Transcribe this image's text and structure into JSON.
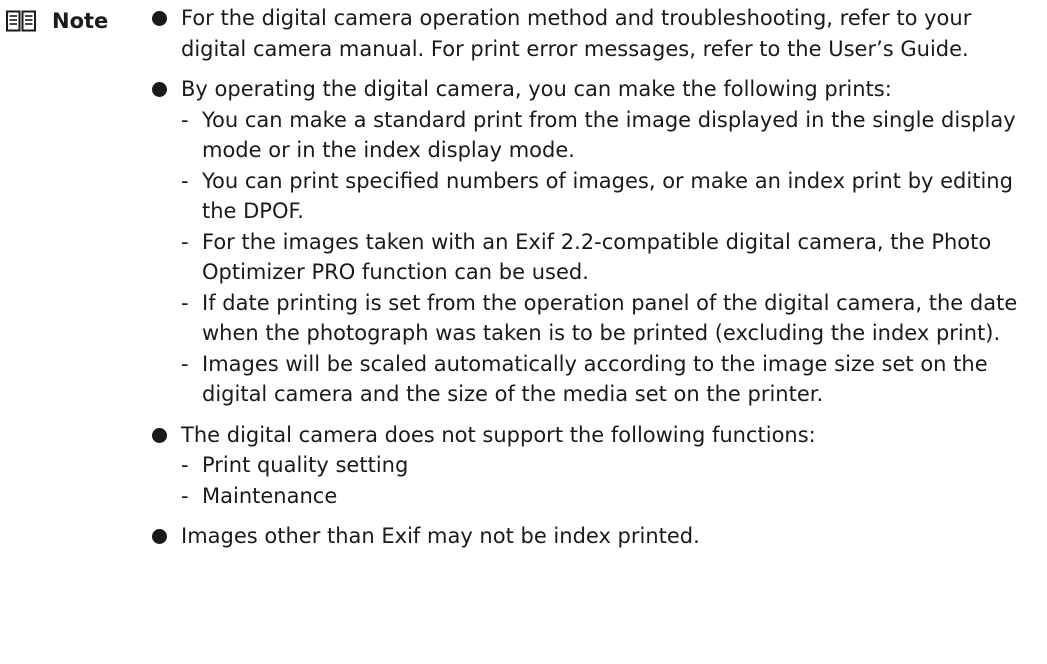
{
  "note": {
    "icon": "note-book-icon",
    "label": "Note"
  },
  "bullets": [
    {
      "text": "For the digital camera operation method and troubleshooting, refer to your digital camera manual. For print error messages, refer to the User’s Guide.",
      "subitems": []
    },
    {
      "text": "By operating the digital camera, you can make the following prints:",
      "subitems": [
        "You can make a standard print from the image displayed in the single display mode or in the index display mode.",
        "You can print specified numbers of images, or make an index print by editing the DPOF.",
        "For the images taken with an Exif 2.2-compatible digital camera, the Photo Optimizer PRO function can be used.",
        "If date printing is set from the operation panel of the digital camera, the date when the photograph was taken is to be printed (excluding the index print).",
        "Images will be scaled automatically according to the image size set on the digital camera and the size of the media set on the printer."
      ]
    },
    {
      "text": "The digital camera does not support the following functions:",
      "subitems": [
        "Print quality setting",
        "Maintenance"
      ]
    },
    {
      "text": "Images other than Exif may not be index printed.",
      "subitems": []
    }
  ],
  "subitem_marker": "-"
}
